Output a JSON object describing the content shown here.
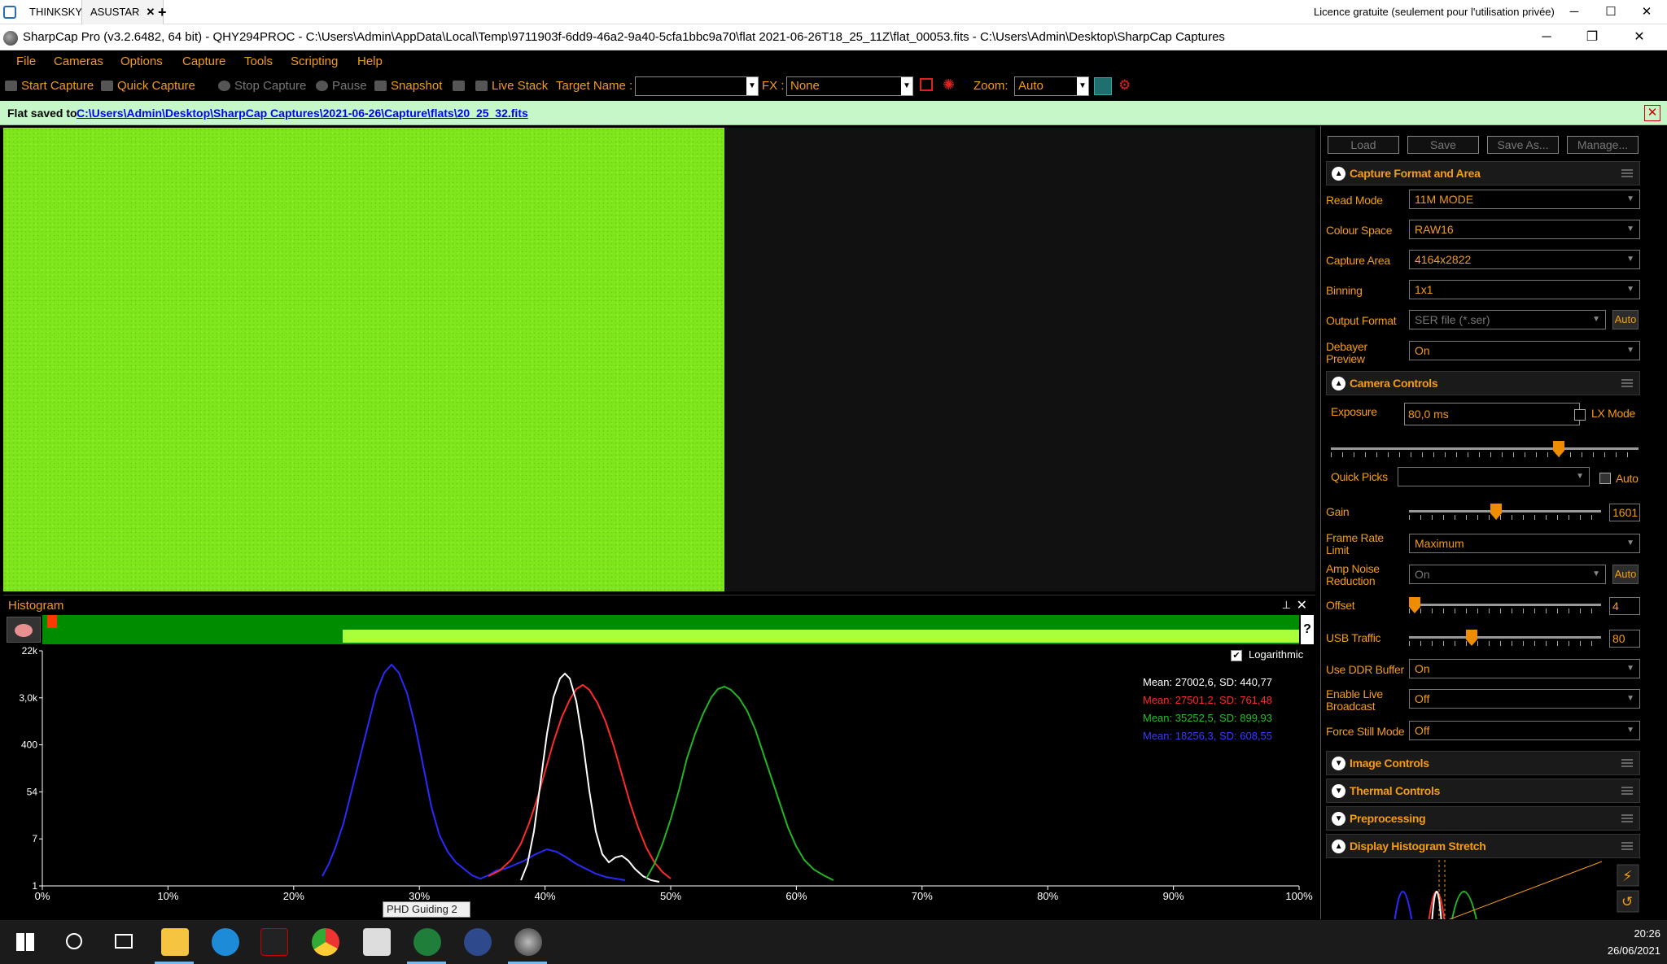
{
  "remote": {
    "tab1": "THINKSKY",
    "tab2": "ASUSTAR",
    "tab2_close": "✕",
    "plus": "+",
    "license": "Licence gratuite (seulement pour l'utilisation privée)",
    "min": "─",
    "max": "☐",
    "close": "✕"
  },
  "window": {
    "title": "SharpCap Pro (v3.2.6482, 64 bit) - QHY294PROC - C:\\Users\\Admin\\AppData\\Local\\Temp\\9711903f-6dd9-46a2-9a40-5cfa1bbc9a70\\flat 2021-06-26T18_25_11Z\\flat_00053.fits - C:\\Users\\Admin\\Desktop\\SharpCap Captures",
    "min": "─",
    "restore": "❐",
    "close": "✕"
  },
  "menu": [
    "File",
    "Cameras",
    "Options",
    "Capture",
    "Tools",
    "Scripting",
    "Help"
  ],
  "toolbar": {
    "start_capture": "Start Capture",
    "quick_capture": "Quick Capture",
    "stop_capture": "Stop Capture",
    "pause": "Pause",
    "snapshot": "Snapshot",
    "live_stack": "Live Stack",
    "target_name_label": "Target Name :",
    "target_name_value": "",
    "fx_label": "FX :",
    "fx_value": "None",
    "zoom_label": "Zoom:",
    "zoom_value": "Auto"
  },
  "notification": {
    "prefix": "Flat saved to",
    "path": "C:\\Users\\Admin\\Desktop\\SharpCap Captures\\2021-06-26\\Capture\\flats\\20_25_32.fits",
    "close": "✕"
  },
  "histogram": {
    "title": "Histogram",
    "pin": "📌",
    "close": "✕",
    "help": "?",
    "logarithmic_label": "Logarithmic",
    "logarithmic_checked": true,
    "y_ticks": [
      "22k",
      "3,0k",
      "400",
      "54",
      "7",
      "1"
    ],
    "x_ticks": [
      "0%",
      "10%",
      "20%",
      "30%",
      "40%",
      "50%",
      "60%",
      "70%",
      "80%",
      "90%",
      "100%"
    ],
    "stats": [
      {
        "text": "Mean: 27002,6, SD: 440,77",
        "color": "#ffffff"
      },
      {
        "text": "Mean: 27501,2, SD: 761,48",
        "color": "#ff2a2a"
      },
      {
        "text": "Mean: 35252,5, SD: 899,93",
        "color": "#22c022"
      },
      {
        "text": "Mean: 18256,3, SD: 608,55",
        "color": "#3a3aff"
      }
    ]
  },
  "panel": {
    "buttons": {
      "load": "Load",
      "save": "Save",
      "save_as": "Save As...",
      "manage": "Manage..."
    },
    "capture_format": {
      "title": "Capture Format and Area",
      "read_mode": {
        "label": "Read Mode",
        "value": "11M MODE"
      },
      "colour_space": {
        "label": "Colour Space",
        "value": "RAW16"
      },
      "capture_area": {
        "label": "Capture Area",
        "value": "4164x2822"
      },
      "binning": {
        "label": "Binning",
        "value": "1x1"
      },
      "output_format": {
        "label": "Output Format",
        "value": "SER file (*.ser)",
        "auto": "Auto"
      },
      "debayer": {
        "label": "Debayer Preview",
        "value": "On"
      }
    },
    "camera_controls": {
      "title": "Camera Controls",
      "exposure": {
        "label": "Exposure",
        "value": "80,0 ms",
        "lx_label": "LX Mode",
        "level": 0.78
      },
      "quick_picks": {
        "label": "Quick Picks",
        "value": "",
        "auto": "Auto"
      },
      "gain": {
        "label": "Gain",
        "value": "1601",
        "level": 0.45
      },
      "frame_rate": {
        "label": "Frame Rate Limit",
        "value": "Maximum"
      },
      "amp_noise": {
        "label": "Amp Noise Reduction",
        "value": "On",
        "auto": "Auto"
      },
      "offset": {
        "label": "Offset",
        "value": "4",
        "level": 0.02
      },
      "usb": {
        "label": "USB Traffic",
        "value": "80",
        "level": 0.32
      },
      "ddr": {
        "label": "Use DDR Buffer",
        "value": "On"
      },
      "live_broadcast": {
        "label": "Enable Live Broadcast",
        "value": "Off"
      },
      "force_still": {
        "label": "Force Still Mode",
        "value": "Off"
      }
    },
    "image_controls": "Image Controls",
    "thermal_controls": "Thermal Controls",
    "preprocessing": "Preprocessing",
    "display_stretch": "Display Histogram Stretch"
  },
  "taskbar": {
    "time": "20:26",
    "date": "26/06/2021",
    "tooltip": "PHD Guiding 2"
  }
}
